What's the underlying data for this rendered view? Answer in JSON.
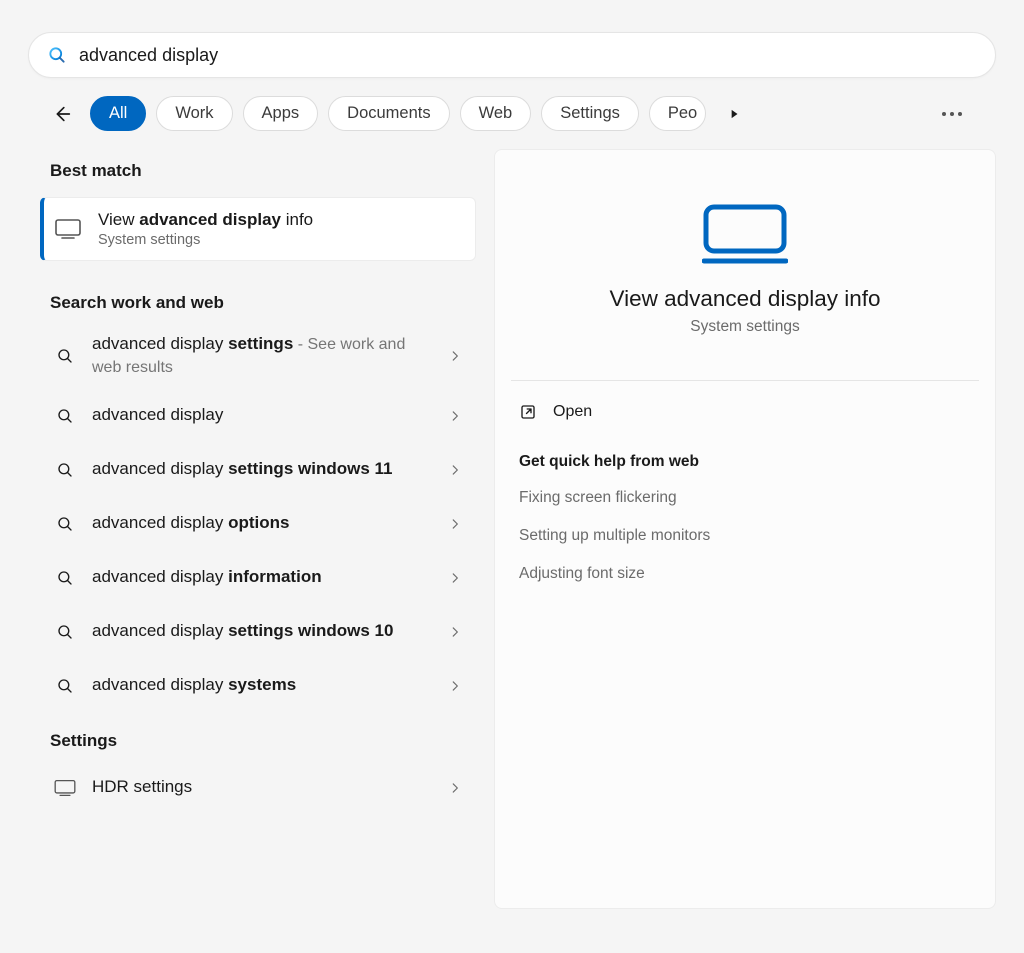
{
  "search": {
    "value": "advanced display"
  },
  "filters": {
    "items": [
      {
        "label": "All",
        "active": true
      },
      {
        "label": "Work",
        "active": false
      },
      {
        "label": "Apps",
        "active": false
      },
      {
        "label": "Documents",
        "active": false
      },
      {
        "label": "Web",
        "active": false
      },
      {
        "label": "Settings",
        "active": false
      },
      {
        "label": "Peo",
        "active": false
      }
    ]
  },
  "sections": {
    "best_match_heading": "Best match",
    "search_web_heading": "Search work and web",
    "settings_heading": "Settings"
  },
  "best_match": {
    "title_pre": "View ",
    "title_bold": "advanced display",
    "title_post": " info",
    "subtitle": "System settings"
  },
  "web_results": [
    {
      "pre": "advanced display ",
      "bold": "settings",
      "post": "",
      "suffix": " - See work and web results"
    },
    {
      "pre": "advanced display",
      "bold": "",
      "post": "",
      "suffix": ""
    },
    {
      "pre": "advanced display ",
      "bold": "settings windows 11",
      "post": "",
      "suffix": ""
    },
    {
      "pre": "advanced display ",
      "bold": "options",
      "post": "",
      "suffix": ""
    },
    {
      "pre": "advanced display ",
      "bold": "information",
      "post": "",
      "suffix": ""
    },
    {
      "pre": "advanced display ",
      "bold": "settings windows 10",
      "post": "",
      "suffix": ""
    },
    {
      "pre": "advanced display ",
      "bold": "systems",
      "post": "",
      "suffix": ""
    }
  ],
  "settings_results": [
    {
      "label": "HDR settings"
    }
  ],
  "preview": {
    "title": "View advanced display info",
    "subtitle": "System settings",
    "open_label": "Open",
    "help_heading": "Get quick help from web",
    "help_links": [
      "Fixing screen flickering",
      "Setting up multiple monitors",
      "Adjusting font size"
    ]
  }
}
